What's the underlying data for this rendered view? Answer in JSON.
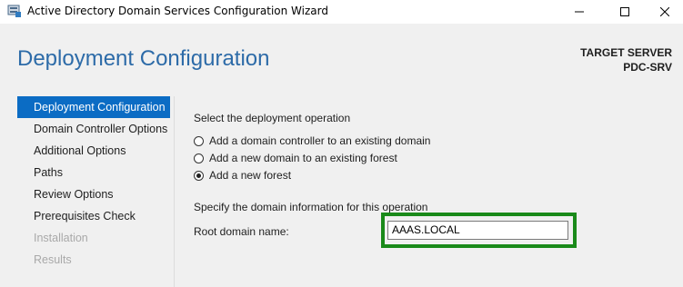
{
  "window": {
    "title": "Active Directory Domain Services Configuration Wizard"
  },
  "header": {
    "page_title": "Deployment Configuration",
    "target_server_label": "TARGET SERVER",
    "target_server_name": "PDC-SRV"
  },
  "nav": {
    "items": [
      {
        "label": "Deployment Configuration",
        "state": "active"
      },
      {
        "label": "Domain Controller Options",
        "state": "enabled"
      },
      {
        "label": "Additional Options",
        "state": "enabled"
      },
      {
        "label": "Paths",
        "state": "enabled"
      },
      {
        "label": "Review Options",
        "state": "enabled"
      },
      {
        "label": "Prerequisites Check",
        "state": "enabled"
      },
      {
        "label": "Installation",
        "state": "disabled"
      },
      {
        "label": "Results",
        "state": "disabled"
      }
    ]
  },
  "main": {
    "operation_prompt": "Select the deployment operation",
    "options": [
      {
        "label": "Add a domain controller to an existing domain",
        "checked": false
      },
      {
        "label": "Add a new domain to an existing forest",
        "checked": false
      },
      {
        "label": "Add a new forest",
        "checked": true
      }
    ],
    "domain_info_prompt": "Specify the domain information for this operation",
    "root_domain_label": "Root domain name:",
    "root_domain_value": "AAAS.LOCAL"
  },
  "colors": {
    "accent": "#2d6ba8",
    "nav_active": "#0b6cc4",
    "highlight_box": "#1a8a1a"
  }
}
